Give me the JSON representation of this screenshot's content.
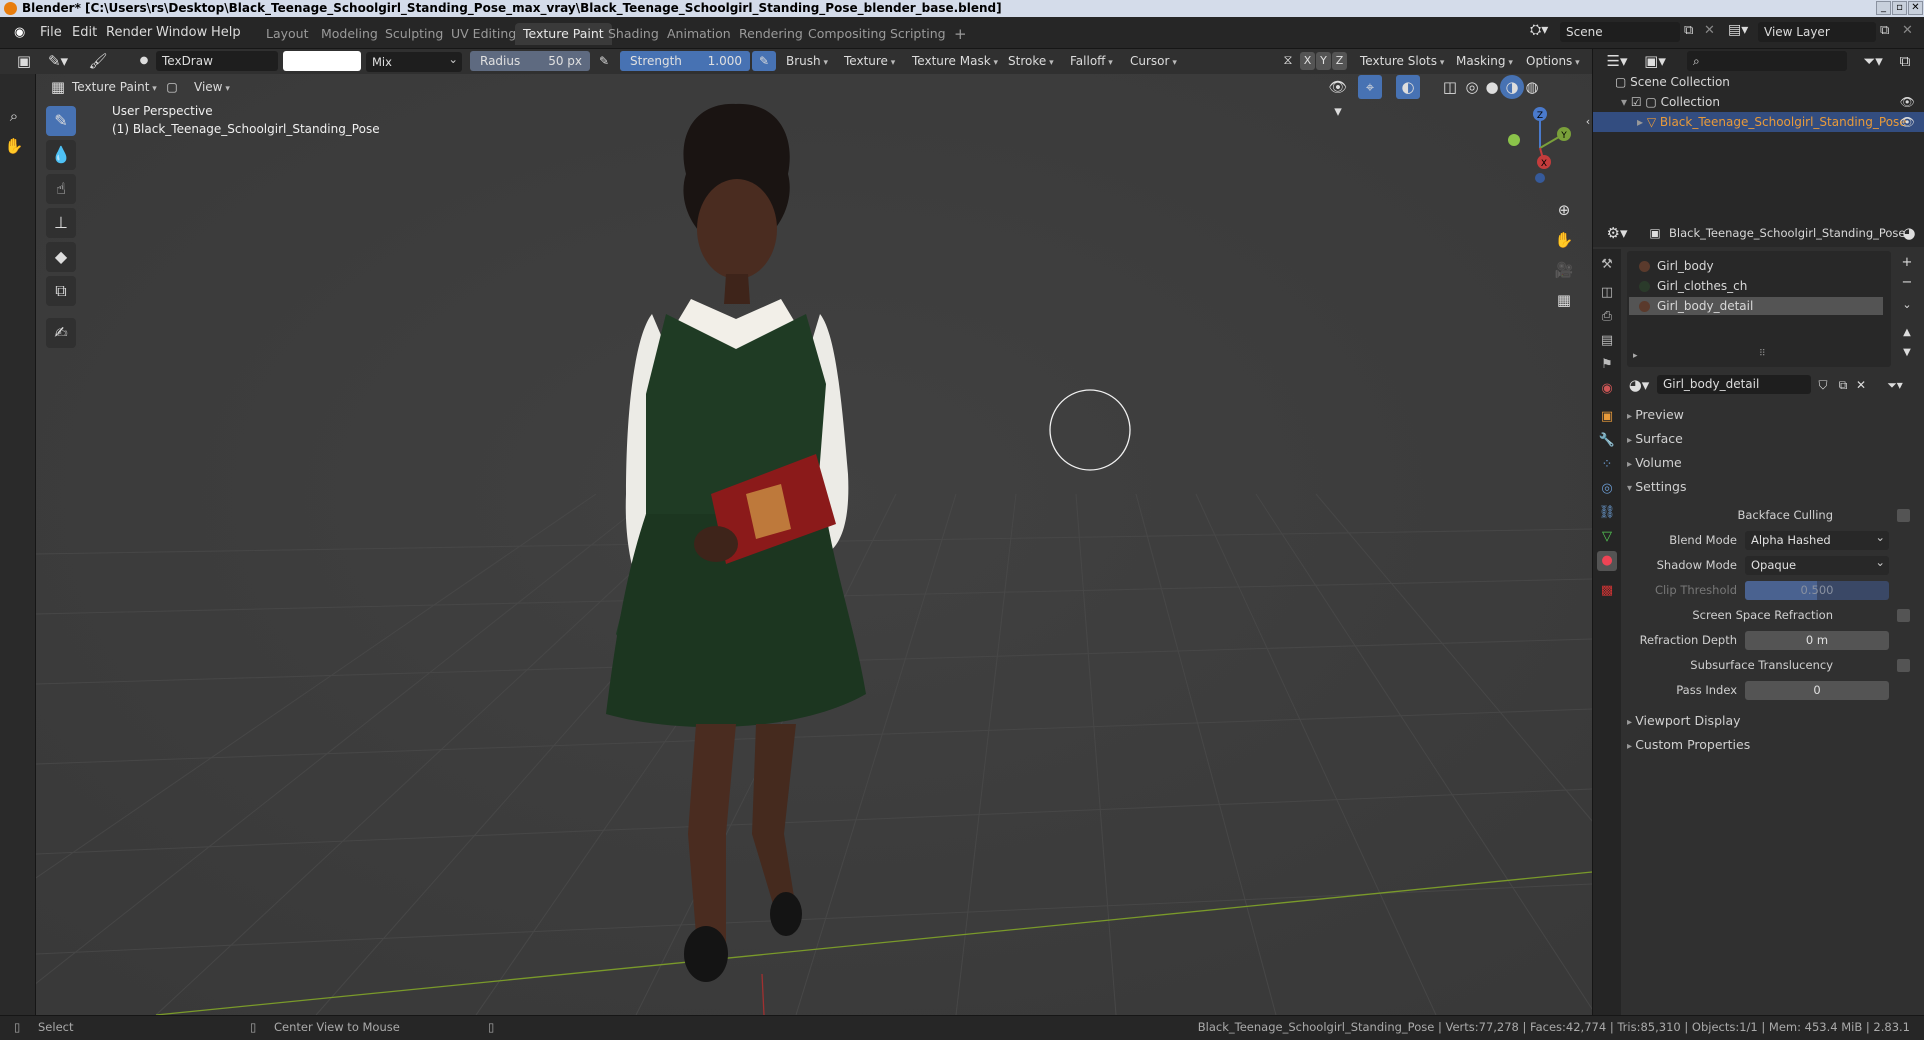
{
  "window": {
    "title": "Blender* [C:\\Users\\rs\\Desktop\\Black_Teenage_Schoolgirl_Standing_Pose_max_vray\\Black_Teenage_Schoolgirl_Standing_Pose_blender_base.blend]"
  },
  "menu": {
    "items": [
      "File",
      "Edit",
      "Render",
      "Window",
      "Help"
    ]
  },
  "workspaces": [
    {
      "label": "Layout",
      "active": false
    },
    {
      "label": "Modeling",
      "active": false
    },
    {
      "label": "Sculpting",
      "active": false
    },
    {
      "label": "UV Editing",
      "active": false
    },
    {
      "label": "Texture Paint",
      "active": true
    },
    {
      "label": "Shading",
      "active": false
    },
    {
      "label": "Animation",
      "active": false
    },
    {
      "label": "Rendering",
      "active": false
    },
    {
      "label": "Compositing",
      "active": false
    },
    {
      "label": "Scripting",
      "active": false
    }
  ],
  "add_workspace": "+",
  "scene": {
    "label": "Scene",
    "view_layer": "View Layer"
  },
  "tool_header": {
    "brush_name": "TexDraw",
    "color": "#ffffff",
    "blend": "Mix",
    "radius_label": "Radius",
    "radius_value": "50 px",
    "strength_label": "Strength",
    "strength_value": "1.000",
    "strength_fill": 1.0,
    "menus": [
      "Brush",
      "Texture",
      "Texture Mask",
      "Stroke",
      "Falloff",
      "Cursor"
    ],
    "axes": [
      "X",
      "Y",
      "Z"
    ],
    "right_menus": [
      "Texture Slots",
      "Masking",
      "Options"
    ]
  },
  "viewport_header": {
    "mode": "Texture Paint",
    "view": "View"
  },
  "viewport": {
    "perspective": "User Perspective",
    "object": "(1) Black_Teenage_Schoolgirl_Standing_Pose",
    "gizmo": {
      "z": "Z",
      "y": "Y",
      "x": "X"
    }
  },
  "outliner": {
    "root": "Scene Collection",
    "collection": "Collection",
    "object": "Black_Teenage_Schoolgirl_Standing_Pose",
    "search_placeholder": ""
  },
  "properties": {
    "object_name": "Black_Teenage_Schoolgirl_Standing_Pose",
    "material_slots": [
      {
        "name": "Girl_body",
        "color": "#5a3a2c",
        "selected": false
      },
      {
        "name": "Girl_clothes_ch",
        "color": "#2a3a2a",
        "selected": false
      },
      {
        "name": "Girl_body_detail",
        "color": "#5a3a2c",
        "selected": true
      }
    ],
    "material": "Girl_body_detail",
    "sections": [
      {
        "label": "Preview",
        "open": false
      },
      {
        "label": "Surface",
        "open": false
      },
      {
        "label": "Volume",
        "open": false
      },
      {
        "label": "Settings",
        "open": true
      }
    ],
    "settings": {
      "backface_culling": "Backface Culling",
      "blend_mode_label": "Blend Mode",
      "blend_mode": "Alpha Hashed",
      "shadow_mode_label": "Shadow Mode",
      "shadow_mode": "Opaque",
      "clip_threshold_label": "Clip Threshold",
      "clip_threshold": "0.500",
      "ssr": "Screen Space Refraction",
      "refraction_depth_label": "Refraction Depth",
      "refraction_depth": "0 m",
      "subsurface": "Subsurface Translucency",
      "pass_index_label": "Pass Index",
      "pass_index": "0"
    },
    "more_sections": [
      "Viewport Display",
      "Custom Properties"
    ]
  },
  "status": {
    "select": "Select",
    "center": "Center View to Mouse",
    "info": "Black_Teenage_Schoolgirl_Standing_Pose | Verts:77,278 | Faces:42,774 | Tris:85,310 | Objects:1/1 | Mem: 453.4 MiB | 2.83.1"
  },
  "colors": {
    "accent": "#4772b3",
    "active_object": "#e89a3a",
    "grid_x": "#7a9a2a"
  }
}
